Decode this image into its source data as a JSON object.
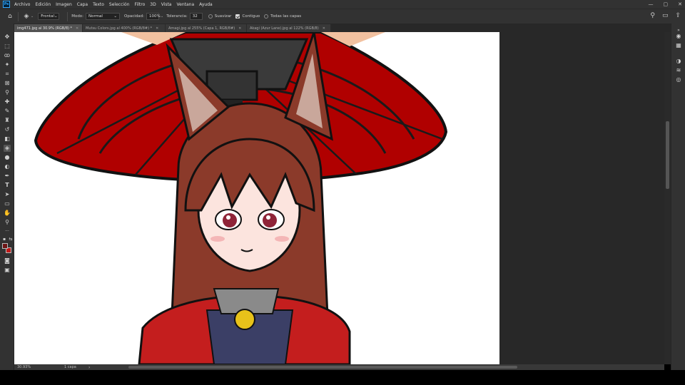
{
  "app": {
    "logo_text": "Ps"
  },
  "menubar": {
    "items": [
      "Archivo",
      "Edición",
      "Imagen",
      "Capa",
      "Texto",
      "Selección",
      "Filtro",
      "3D",
      "Vista",
      "Ventana",
      "Ayuda"
    ],
    "window_controls": [
      "—",
      "▢",
      "✕"
    ]
  },
  "options": {
    "fill_source": "Frontal",
    "mode_label": "Modo:",
    "mode_value": "Normal",
    "opacity_label": "Opacidad:",
    "opacity_value": "100%",
    "tolerance_label": "Tolerancia:",
    "tolerance_value": "32",
    "antialias_label": "Suavizar",
    "antialias_checked": false,
    "contiguous_label": "Contiguo",
    "contiguous_checked": true,
    "all_layers_label": "Todas las capas",
    "all_layers_checked": false
  },
  "tabs": [
    {
      "label": "img471.jpg al 30.9% (RGB/8) *",
      "active": true
    },
    {
      "label": "Mutsu Colors.jpg al 400% (RGB/8#) *",
      "active": false
    },
    {
      "label": "Amagi.jpg al 255% (Capa 1, RGB/8#)",
      "active": false
    },
    {
      "label": "Akagi (Azur Lane).jpg al 122% (RGB/8)",
      "active": false
    }
  ],
  "tools": [
    {
      "name": "move-tool",
      "icon": "✥"
    },
    {
      "name": "marquee-tool",
      "icon": "⬚"
    },
    {
      "name": "lasso-tool",
      "icon": "ꝏ"
    },
    {
      "name": "magic-wand-tool",
      "icon": "✦"
    },
    {
      "name": "crop-tool",
      "icon": "⌗"
    },
    {
      "name": "frame-tool",
      "icon": "⊠"
    },
    {
      "name": "eyedropper-tool",
      "icon": "⚲"
    },
    {
      "name": "healing-brush-tool",
      "icon": "✚"
    },
    {
      "name": "brush-tool",
      "icon": "✎"
    },
    {
      "name": "clone-stamp-tool",
      "icon": "♜"
    },
    {
      "name": "history-brush-tool",
      "icon": "↺"
    },
    {
      "name": "eraser-tool",
      "icon": "◧"
    },
    {
      "name": "paint-bucket-tool",
      "icon": "◈"
    },
    {
      "name": "blur-tool",
      "icon": "●"
    },
    {
      "name": "dodge-tool",
      "icon": "◐"
    },
    {
      "name": "pen-tool",
      "icon": "✒"
    },
    {
      "name": "type-tool",
      "icon": "T"
    },
    {
      "name": "path-selection-tool",
      "icon": "➤"
    },
    {
      "name": "rectangle-tool",
      "icon": "▭"
    },
    {
      "name": "hand-tool",
      "icon": "✋"
    },
    {
      "name": "zoom-tool",
      "icon": "⚲"
    },
    {
      "name": "more-tools",
      "icon": "···"
    }
  ],
  "colors": {
    "foreground": "#6e1616",
    "background": "#c01818",
    "accent": "#31a8ff"
  },
  "dock": [
    {
      "name": "properties-panel-icon",
      "icon": "◉"
    },
    {
      "name": "swatches-panel-icon",
      "icon": "▦"
    },
    {
      "name": "adjustments-panel-icon",
      "icon": "◑"
    },
    {
      "name": "layers-panel-icon",
      "icon": "≋"
    },
    {
      "name": "channels-panel-icon",
      "icon": "◎"
    }
  ],
  "status": {
    "zoom": "30.93%",
    "info": "1 capa",
    "arrow": "›"
  }
}
